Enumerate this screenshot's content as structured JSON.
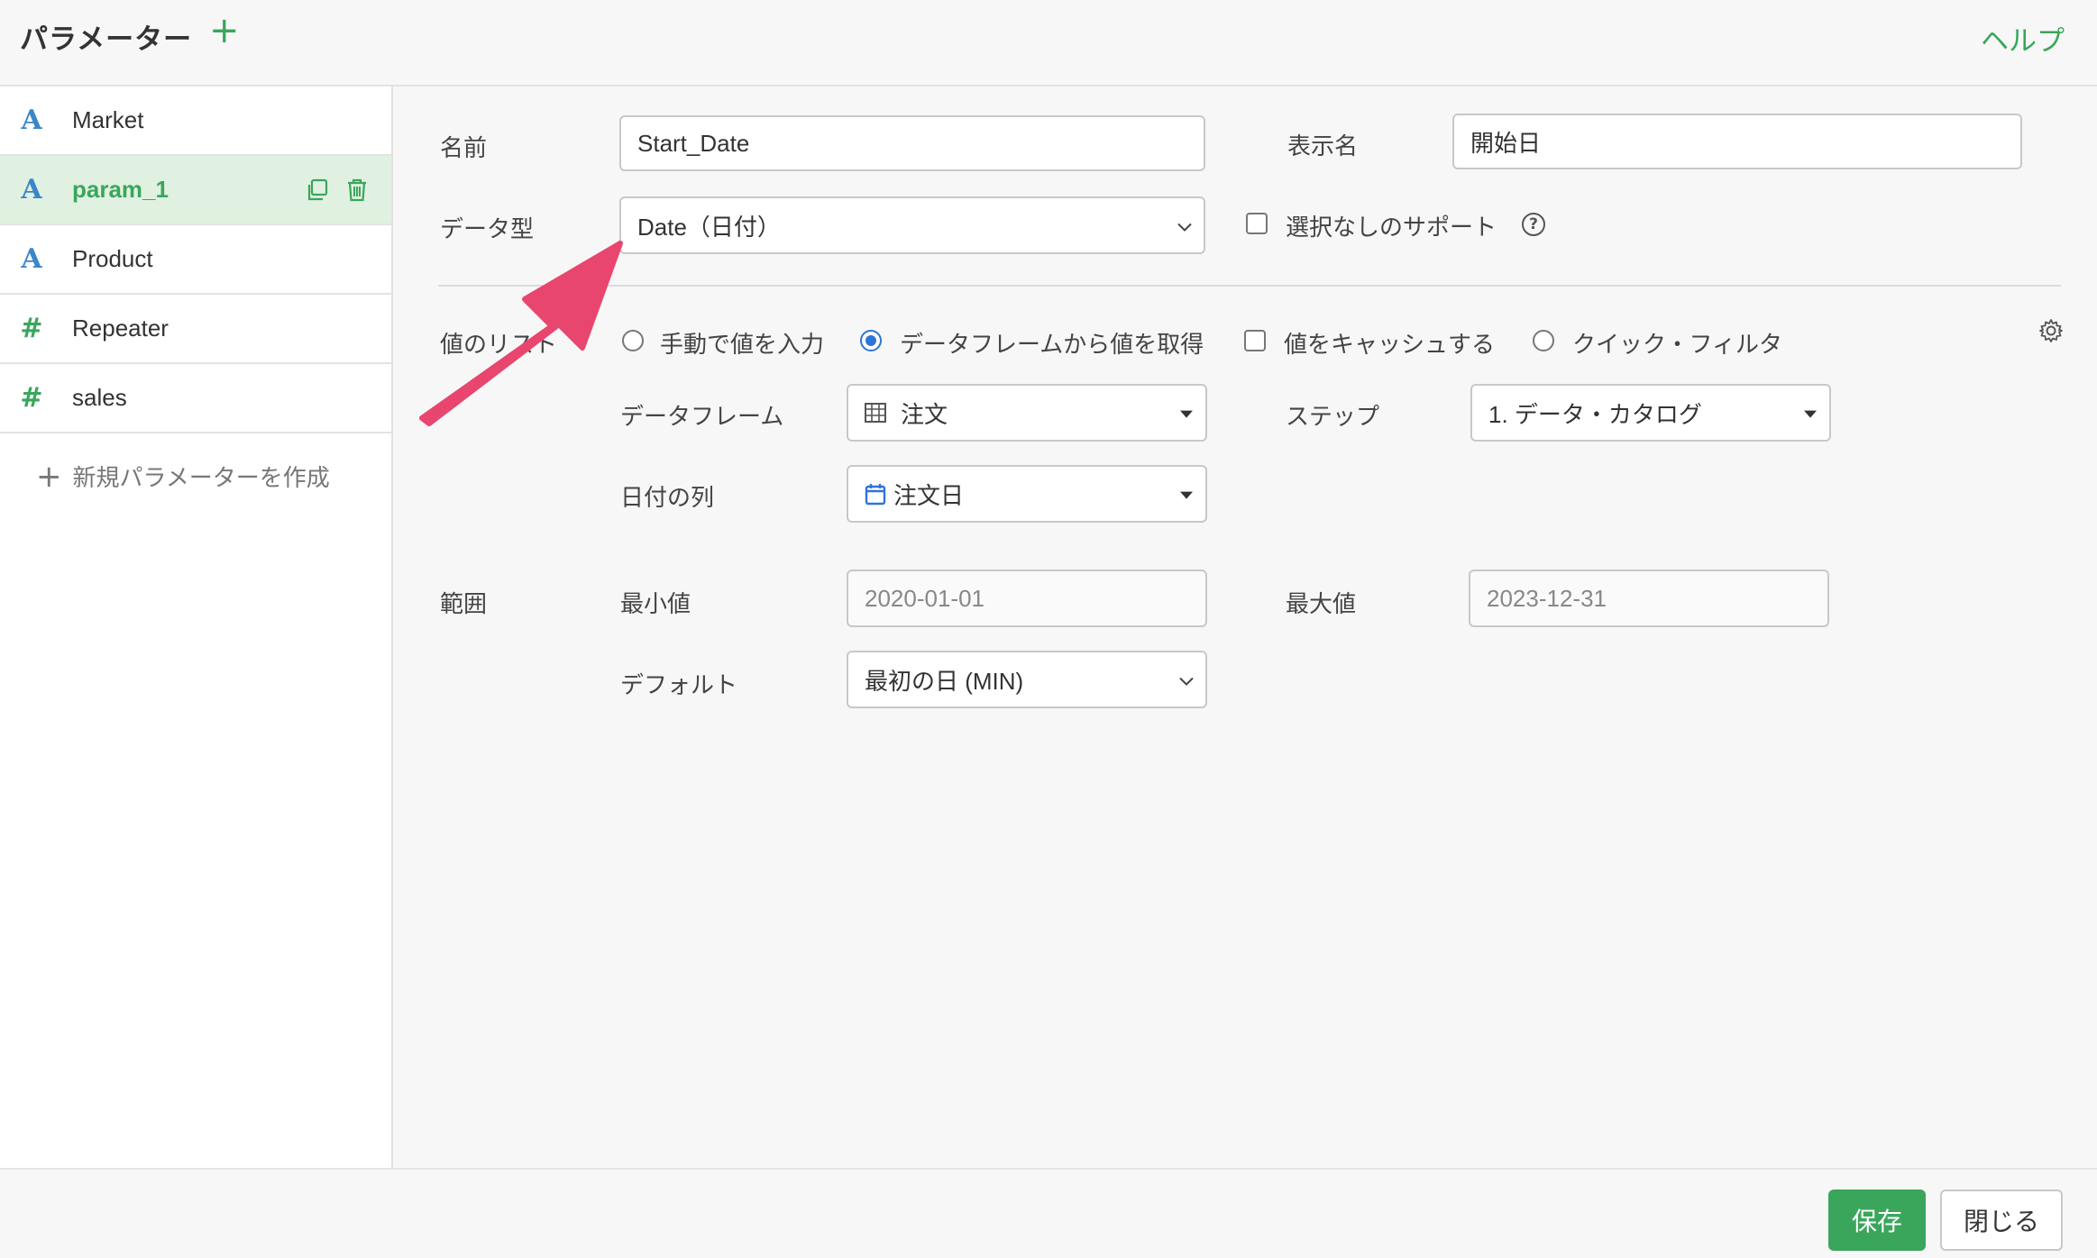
{
  "header": {
    "title": "パラメーター",
    "add_symbol": "+",
    "help_label": "ヘルプ"
  },
  "sidebar": {
    "items": [
      {
        "icon": "A",
        "label": "Market"
      },
      {
        "icon": "A",
        "label": "param_1"
      },
      {
        "icon": "A",
        "label": "Product"
      },
      {
        "icon": "#",
        "label": "Repeater"
      },
      {
        "icon": "#",
        "label": "sales"
      }
    ],
    "new_param_label": "新規パラメーターを作成"
  },
  "form": {
    "name_label": "名前",
    "name_value": "Start_Date",
    "display_name_label": "表示名",
    "display_name_value": "開始日",
    "data_type_label": "データ型",
    "data_type_value": "Date（日付）",
    "support_none_label": "選択なしのサポート",
    "help_symbol": "?",
    "value_list_label": "値のリスト",
    "value_options": [
      "手動で値を入力",
      "データフレームから値を取得"
    ],
    "cache_label": "値をキャッシュする",
    "quick_filter_label": "クイック・フィルタ",
    "dataframe_label": "データフレーム",
    "dataframe_value": "注文",
    "step_label": "ステップ",
    "step_value": "1. データ・カタログ",
    "date_column_label": "日付の列",
    "date_column_value": "注文日",
    "range_label": "範囲",
    "min_label": "最小値",
    "min_value": "2020-01-01",
    "max_label": "最大値",
    "max_value": "2023-12-31",
    "default_label": "デフォルト",
    "default_value": "最初の日 (MIN)"
  },
  "footer": {
    "save_label": "保存",
    "close_label": "閉じる"
  },
  "colors": {
    "accent": "#3aa65b",
    "radio": "#2f74d8",
    "arrow": "#e8466e",
    "type_icon": "#3a87c8"
  }
}
